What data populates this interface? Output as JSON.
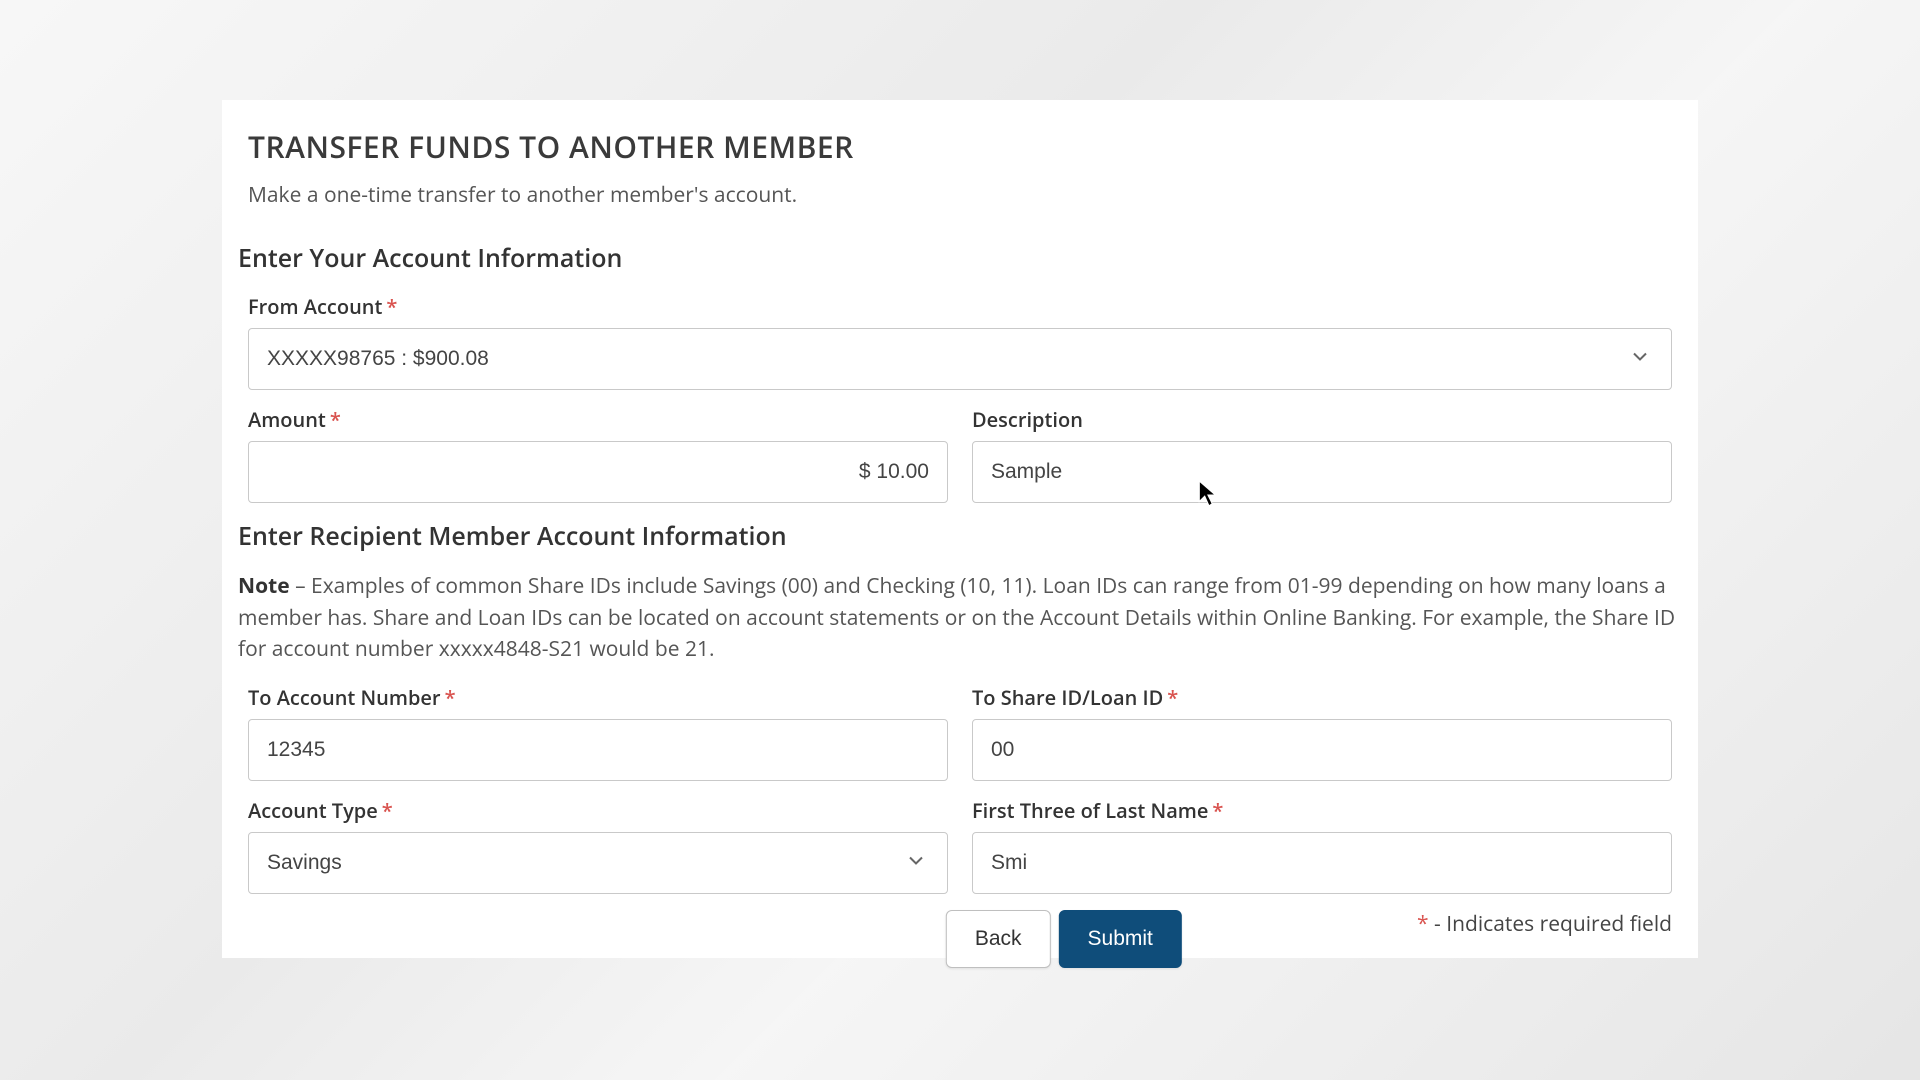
{
  "page": {
    "title": "TRANSFER FUNDS TO ANOTHER MEMBER",
    "subtitle": "Make a one-time transfer to another member's account."
  },
  "section1": {
    "heading": "Enter Your Account Information",
    "from_account": {
      "label": "From Account",
      "value": "XXXXX98765 : $900.08"
    },
    "amount": {
      "label": "Amount",
      "value": "$ 10.00"
    },
    "description": {
      "label": "Description",
      "value": "Sample"
    }
  },
  "section2": {
    "heading": "Enter Recipient Member Account Information",
    "note_prefix": "Note",
    "note_body": " – Examples of common Share IDs include Savings (00) and Checking (10, 11). Loan IDs can range from 01-99 depending on how many loans a member has. Share and Loan IDs can be located on account statements or on the Account Details within Online Banking. For example, the Share ID for account number xxxxx4848-S21 would be 21.",
    "to_account_number": {
      "label": "To Account Number",
      "value": "12345"
    },
    "to_share_id": {
      "label": "To Share ID/Loan ID",
      "value": "00"
    },
    "account_type": {
      "label": "Account Type",
      "value": "Savings"
    },
    "last_name": {
      "label": "First Three of Last Name",
      "value": "Smi"
    }
  },
  "buttons": {
    "back": "Back",
    "submit": "Submit"
  },
  "required_note": {
    "star": "*",
    "text": " - Indicates required field"
  },
  "asterisk": "*"
}
